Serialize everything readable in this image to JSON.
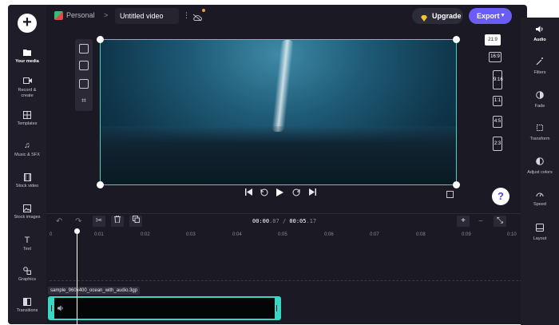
{
  "topbar": {
    "project": "Personal",
    "separator": ">",
    "title": "Untitled video",
    "kebab": "⋮",
    "upgrade_label": "Upgrade",
    "export_label": "Export"
  },
  "sidebar": {
    "add_label": "+",
    "items": [
      {
        "label": "Your media",
        "icon": "folder-icon"
      },
      {
        "label": "Record &\ncreate",
        "icon": "camera-icon"
      },
      {
        "label": "Templates",
        "icon": "templates-icon"
      },
      {
        "label": "Music & SFX",
        "icon": "music-icon"
      },
      {
        "label": "Stock video",
        "icon": "film-icon"
      },
      {
        "label": "Stock images",
        "icon": "image-icon"
      },
      {
        "label": "Text",
        "icon": "text-icon"
      },
      {
        "label": "Graphics",
        "icon": "shapes-icon"
      },
      {
        "label": "Transitions",
        "icon": "transitions-icon"
      }
    ]
  },
  "aspect_ratios": [
    "21:9",
    "16:9",
    "9:16",
    "1:1",
    "4:5",
    "2:3"
  ],
  "active_ratio": "21:9",
  "help_label": "?",
  "right_panel": {
    "items": [
      {
        "label": "Audio",
        "icon": "speaker-icon"
      },
      {
        "label": "Filters",
        "icon": "wand-icon"
      },
      {
        "label": "Fade",
        "icon": "fade-icon"
      },
      {
        "label": "Transform",
        "icon": "transform-icon"
      },
      {
        "label": "Adjust colors",
        "icon": "contrast-icon"
      },
      {
        "label": "Speed",
        "icon": "speed-icon"
      },
      {
        "label": "Layout",
        "icon": "layout-icon"
      }
    ]
  },
  "timeline": {
    "current_time": "00:00",
    "current_frac": ".07",
    "separator": " / ",
    "total_time": "00:05",
    "total_frac": ".17",
    "ticks": [
      "0",
      "0:01",
      "0:02",
      "0:03",
      "0:04",
      "0:05",
      "0:06",
      "0:07",
      "0:08",
      "0:09",
      "0:10"
    ],
    "clip_name": "sample_960x400_ocean_with_audio.3gp"
  },
  "colors": {
    "accent": "#6a5cf6",
    "selection": "#39d6c4",
    "background": "#1b1a24"
  }
}
